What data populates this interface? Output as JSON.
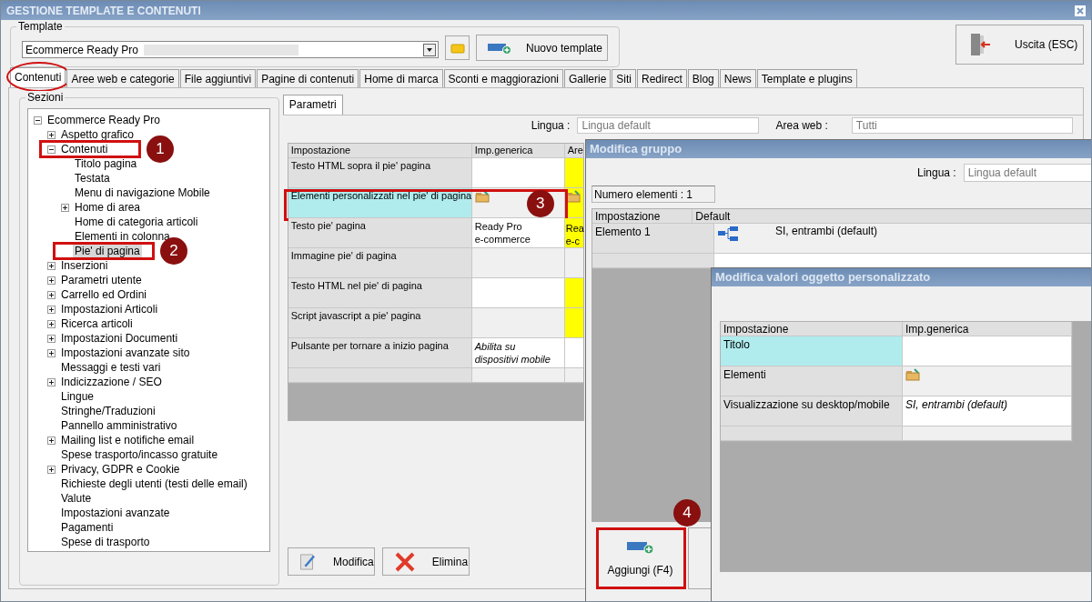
{
  "window": {
    "title": "GESTIONE TEMPLATE E CONTENUTI"
  },
  "template": {
    "label": "Template",
    "value": "Ecommerce Ready Pro",
    "new_button": "Nuovo template"
  },
  "exit_button": "Uscita (ESC)",
  "tabs": [
    {
      "label": "Contenuti",
      "selected": true,
      "circled": true
    },
    {
      "label": "Aree web e categorie",
      "selected": false,
      "circled": false
    },
    {
      "label": "File aggiuntivi",
      "selected": false,
      "circled": false
    },
    {
      "label": "Pagine di contenuti",
      "selected": false,
      "circled": false
    },
    {
      "label": "Home di marca",
      "selected": false,
      "circled": false
    },
    {
      "label": "Sconti e maggiorazioni",
      "selected": false,
      "circled": false
    },
    {
      "label": "Gallerie",
      "selected": false,
      "circled": false
    },
    {
      "label": "Siti",
      "selected": false,
      "circled": false
    },
    {
      "label": "Redirect",
      "selected": false,
      "circled": false
    },
    {
      "label": "Blog",
      "selected": false,
      "circled": false
    },
    {
      "label": "News",
      "selected": false,
      "circled": false
    },
    {
      "label": "Template e plugins",
      "selected": false,
      "circled": false
    }
  ],
  "sections": {
    "title": "Sezioni",
    "tree": [
      {
        "label": "Ecommerce Ready Pro",
        "kind": "group",
        "expanded": true,
        "selected": false,
        "children": [
          {
            "label": "Aspetto grafico",
            "kind": "group",
            "expanded": false,
            "selected": false
          },
          {
            "label": "Contenuti",
            "kind": "group",
            "expanded": true,
            "selected": false,
            "callout": "1",
            "children": [
              {
                "label": "Titolo pagina",
                "kind": "leaf",
                "selected": false
              },
              {
                "label": "Testata",
                "kind": "leaf",
                "selected": false
              },
              {
                "label": "Menu di navigazione Mobile",
                "kind": "leaf",
                "selected": false
              },
              {
                "label": "Home di area",
                "kind": "group",
                "expanded": false,
                "selected": false
              },
              {
                "label": "Home di categoria articoli",
                "kind": "leaf",
                "selected": false
              },
              {
                "label": "Elementi in colonna",
                "kind": "leaf",
                "selected": false
              },
              {
                "label": "Pie' di pagina",
                "kind": "leaf",
                "selected": true,
                "callout": "2"
              }
            ]
          },
          {
            "label": "Inserzioni",
            "kind": "group",
            "expanded": false,
            "selected": false
          },
          {
            "label": "Parametri utente",
            "kind": "group",
            "expanded": false,
            "selected": false
          },
          {
            "label": "Carrello ed Ordini",
            "kind": "group",
            "expanded": false,
            "selected": false
          },
          {
            "label": "Impostazioni Articoli",
            "kind": "group",
            "expanded": false,
            "selected": false
          },
          {
            "label": "Ricerca articoli",
            "kind": "group",
            "expanded": false,
            "selected": false
          },
          {
            "label": "Impostazioni Documenti",
            "kind": "group",
            "expanded": false,
            "selected": false
          },
          {
            "label": "Impostazioni avanzate sito",
            "kind": "group",
            "expanded": false,
            "selected": false
          },
          {
            "label": "Messaggi e testi vari",
            "kind": "leaf",
            "selected": false
          },
          {
            "label": "Indicizzazione / SEO",
            "kind": "group",
            "expanded": false,
            "selected": false
          },
          {
            "label": "Lingue",
            "kind": "leaf",
            "selected": false
          },
          {
            "label": "Stringhe/Traduzioni",
            "kind": "leaf",
            "selected": false
          },
          {
            "label": "Pannello amministrativo",
            "kind": "leaf",
            "selected": false
          },
          {
            "label": "Mailing list e notifiche email",
            "kind": "group",
            "expanded": false,
            "selected": false
          },
          {
            "label": "Spese trasporto/incasso gratuite",
            "kind": "leaf",
            "selected": false
          },
          {
            "label": "Privacy, GDPR e Cookie",
            "kind": "group",
            "expanded": false,
            "selected": false
          },
          {
            "label": "Richieste degli utenti (testi delle email)",
            "kind": "leaf",
            "selected": false
          },
          {
            "label": "Valute",
            "kind": "leaf",
            "selected": false
          },
          {
            "label": "Impostazioni avanzate",
            "kind": "leaf",
            "selected": false
          },
          {
            "label": "Pagamenti",
            "kind": "leaf",
            "selected": false
          },
          {
            "label": "Spese di trasporto",
            "kind": "leaf",
            "selected": false
          }
        ]
      }
    ]
  },
  "parameters": {
    "tab": "Parametri",
    "language_label": "Lingua :",
    "language_value": "Lingua default",
    "area_label": "Area web :",
    "area_value": "Tutti",
    "columns": [
      "Impostazione",
      "Imp.generica",
      "Are"
    ],
    "rows": [
      {
        "setting": "Testo HTML sopra il pie' pagina",
        "selected": false,
        "value": {
          "kind": "empty"
        },
        "column_3": {
          "kind": "empty",
          "highlighted": true
        }
      },
      {
        "setting": "Elementi personalizzati nel pie' di pagina",
        "selected": true,
        "callout": "3",
        "value": {
          "kind": "folder"
        },
        "column_3": {
          "kind": "folder",
          "highlighted": true
        }
      },
      {
        "setting": "Testo pie' pagina",
        "selected": false,
        "value": {
          "kind": "text",
          "text": "Ready Pro\ne-commerce"
        },
        "column_3": {
          "kind": "text",
          "text": "Rea\ne-c",
          "highlighted": true
        }
      },
      {
        "setting": "Immagine pie' di pagina",
        "selected": false,
        "value": {
          "kind": "empty"
        },
        "column_3": {
          "kind": "empty",
          "highlighted": false
        }
      },
      {
        "setting": "Testo HTML nel pie' di pagina",
        "selected": false,
        "value": {
          "kind": "empty"
        },
        "column_3": {
          "kind": "empty",
          "highlighted": true
        }
      },
      {
        "setting": "Script javascript a pie' pagina",
        "selected": false,
        "value": {
          "kind": "empty"
        },
        "column_3": {
          "kind": "empty",
          "highlighted": true
        }
      },
      {
        "setting": "Pulsante per tornare a inizio pagina",
        "selected": false,
        "value": {
          "kind": "italic",
          "text": "Abilita su dispositivi mobile"
        },
        "column_3": {
          "kind": "empty",
          "highlighted": false
        }
      }
    ],
    "buttons": [
      {
        "label": "Modifica",
        "kind": "edit"
      },
      {
        "label": "Elimina",
        "kind": "delete"
      }
    ]
  },
  "group_dialog": {
    "title": "Modifica gruppo",
    "language_label": "Lingua :",
    "language_value": "Lingua default",
    "count": "Numero elementi : 1",
    "columns": [
      "Impostazione",
      "Default"
    ],
    "rows": [
      {
        "setting": "Elemento 1",
        "value": "SI, entrambi (default)"
      }
    ],
    "add_button": {
      "label": "Aggiungi (F4)",
      "callout": "4"
    }
  },
  "object_dialog": {
    "title": "Modifica valori oggetto personalizzato",
    "columns": [
      "Impostazione",
      "Imp.generica"
    ],
    "rows": [
      {
        "setting": "Titolo",
        "selected": true,
        "value": {
          "kind": "empty"
        }
      },
      {
        "setting": "Elementi",
        "selected": false,
        "value": {
          "kind": "folder"
        }
      },
      {
        "setting": "Visualizzazione su desktop/mobile",
        "selected": false,
        "value": {
          "kind": "italic",
          "text": "SI, entrambi (default)"
        }
      }
    ]
  }
}
